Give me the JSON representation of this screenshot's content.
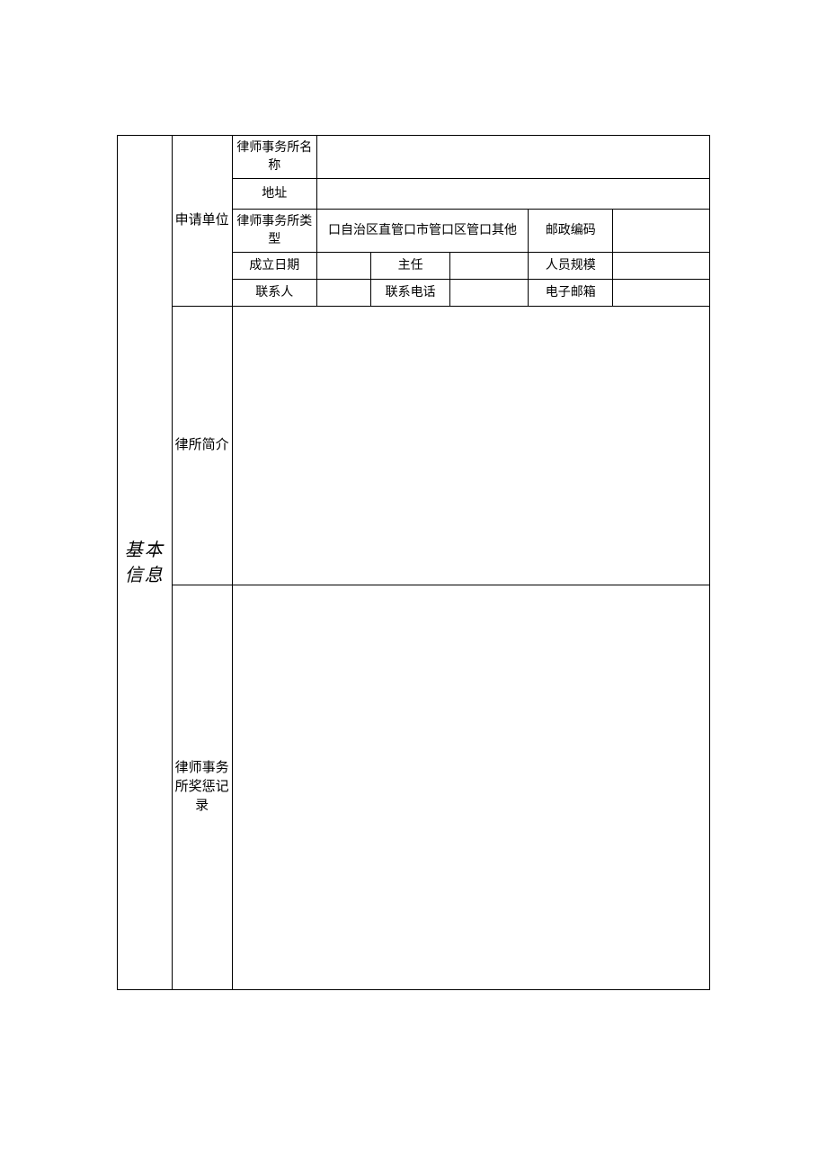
{
  "mainLabel": "基本信息",
  "section1": {
    "label": "申请单位",
    "rows": {
      "firmName": {
        "label": "律师事务所名称",
        "value": ""
      },
      "address": {
        "label": "地址",
        "value": ""
      },
      "firmType": {
        "label": "律师事务所类型",
        "options": "口自治区直管口市管口区管口其他",
        "postalLabel": "邮政编码",
        "postalValue": ""
      },
      "establish": {
        "label": "成立日期",
        "value": "",
        "directorLabel": "主任",
        "directorValue": "",
        "staffLabel": "人员规模",
        "staffValue": ""
      },
      "contact": {
        "label": "联系人",
        "value": "",
        "phoneLabel": "联系电话",
        "phoneValue": "",
        "emailLabel": "电子邮箱",
        "emailValue": ""
      }
    }
  },
  "section2": {
    "label": "律所简介",
    "value": ""
  },
  "section3": {
    "label": "律师事务所奖惩记录",
    "value": ""
  }
}
